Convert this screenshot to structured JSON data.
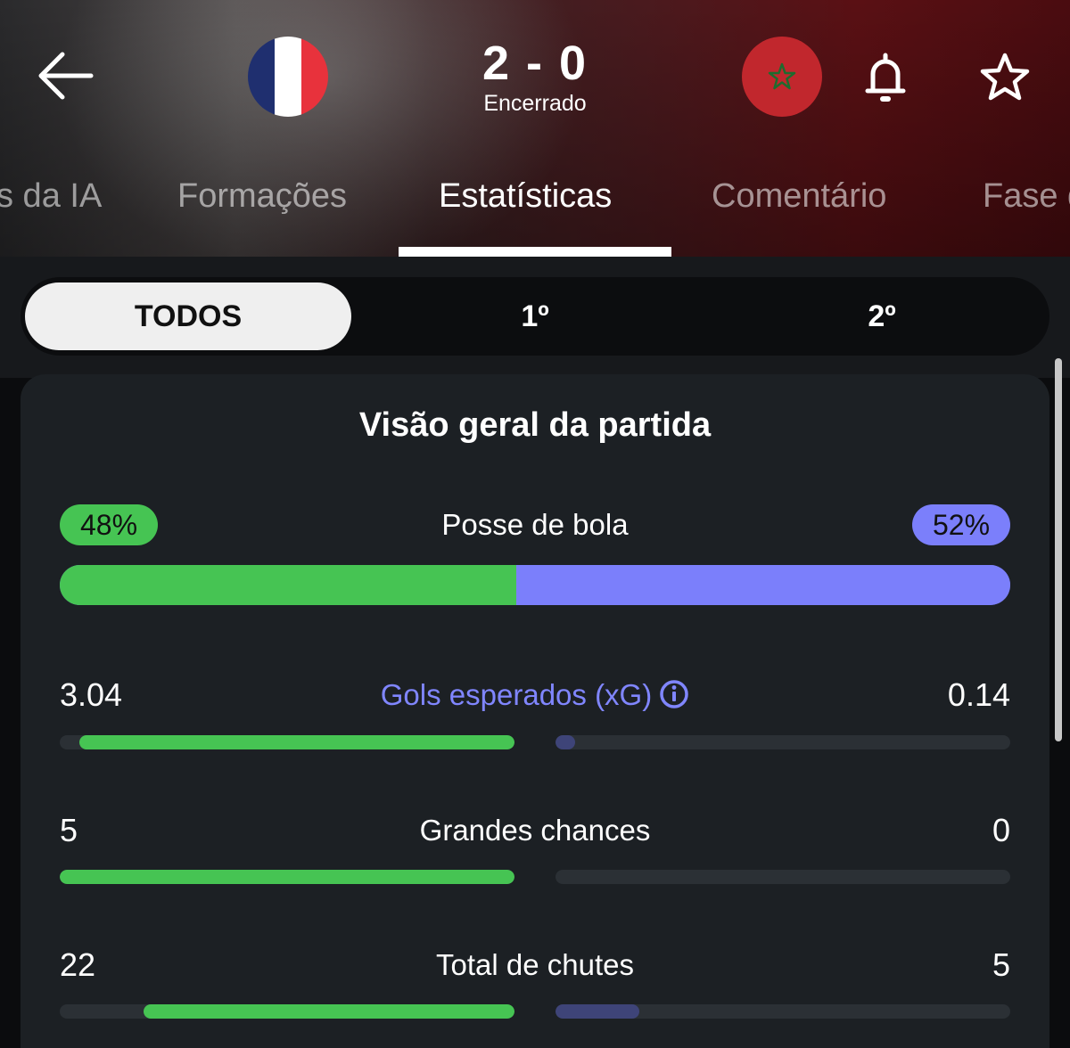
{
  "header": {
    "home_team_flag": "france-flag",
    "away_team_flag": "morocco-flag",
    "score": "2 - 0",
    "status": "Encerrado",
    "icons": {
      "back": "arrow-left-icon",
      "notifications": "bell-icon",
      "favorite": "star-icon"
    }
  },
  "tabs": [
    {
      "label": "Insights da IA",
      "visible_text": "s da IA"
    },
    {
      "label": "Formações"
    },
    {
      "label": "Estatísticas",
      "active": true
    },
    {
      "label": "Comentário"
    },
    {
      "label": "Fase",
      "visible_text": "Fase d"
    }
  ],
  "period_filter": {
    "options": [
      "TODOS",
      "1º",
      "2º"
    ],
    "selected": "TODOS"
  },
  "overview": {
    "title": "Visão geral da partida",
    "possession": {
      "label": "Posse de bola",
      "home": "48%",
      "away": "52%",
      "home_value": 48,
      "away_value": 52
    },
    "stats": [
      {
        "label": "Gols esperados (xG)",
        "home": "3.04",
        "away": "0.14",
        "home_fraction": 0.956,
        "away_fraction": 0.044,
        "info": true
      },
      {
        "label": "Grandes chances",
        "home": "5",
        "away": "0",
        "home_fraction": 1.0,
        "away_fraction": 0.0
      },
      {
        "label": "Total de chutes",
        "home": "22",
        "away": "5",
        "home_fraction": 0.815,
        "away_fraction": 0.185
      }
    ]
  },
  "colors": {
    "home": "#46c453",
    "away": "#7b7ffb",
    "away_dim": "#3e4478",
    "card_bg": "#1c2024",
    "xg_label": "#8086ff"
  }
}
